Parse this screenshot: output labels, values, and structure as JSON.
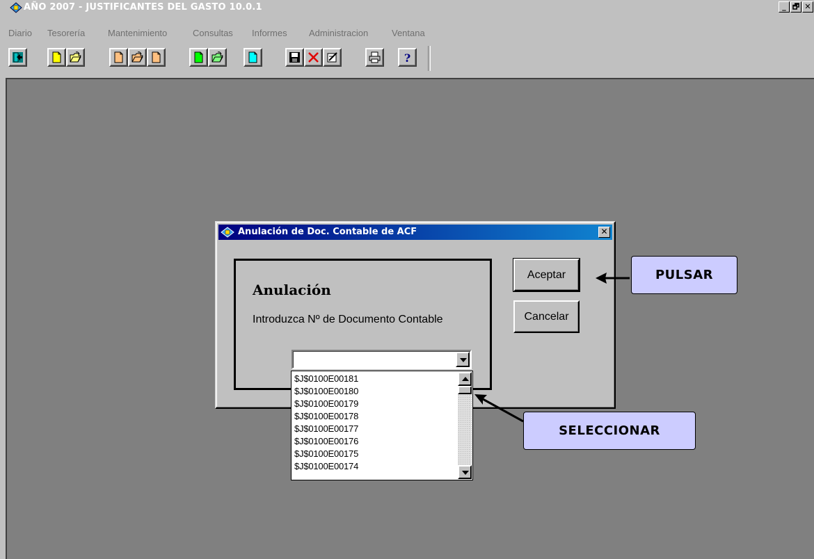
{
  "window": {
    "title": "AÑO 2007 - JUSTIFICANTES DEL GASTO 10.0.1",
    "controls": [
      "_",
      "🗗",
      "✕"
    ]
  },
  "menu": {
    "items": [
      "Diario",
      "Tesorería",
      "Mantenimiento",
      "Consultas",
      "Informes",
      "Administracion",
      "Ventana"
    ]
  },
  "toolbar": {
    "buttons": [
      {
        "icon": "exit-icon"
      },
      {
        "icon": "new-document-icon",
        "color": "#ffff00"
      },
      {
        "icon": "open-folder-icon"
      },
      {
        "icon": "new-document-icon",
        "color": "#ffc080"
      },
      {
        "icon": "open-folder-icon"
      },
      {
        "icon": "document-icon",
        "color": "#ffc080"
      },
      {
        "icon": "new-document-icon",
        "color": "#00ff00"
      },
      {
        "icon": "open-folder-icon"
      },
      {
        "icon": "document-icon",
        "color": "#00ffff"
      },
      {
        "icon": "save-icon"
      },
      {
        "icon": "delete-icon"
      },
      {
        "icon": "edit-icon"
      },
      {
        "icon": "print-icon"
      },
      {
        "icon": "help-icon"
      }
    ]
  },
  "dialog": {
    "title": "Anulación de Doc. Contable de ACF",
    "close_label": "✕",
    "heading": "Anulación",
    "prompt": "Introduzca Nº de Documento Contable",
    "accept_label": "Aceptar",
    "cancel_label": "Cancelar",
    "combo_value": "",
    "dropdown_items": [
      "$J$0100E00181",
      "$J$0100E00180",
      "$J$0100E00179",
      "$J$0100E00178",
      "$J$0100E00177",
      "$J$0100E00176",
      "$J$0100E00175",
      "$J$0100E00174"
    ]
  },
  "annotations": {
    "pulsar": "PULSAR",
    "seleccionar": "SELECCIONAR"
  },
  "colors": {
    "callout_bg": "#ccccff",
    "workspace": "#808080",
    "dialog_title": "#000080"
  }
}
